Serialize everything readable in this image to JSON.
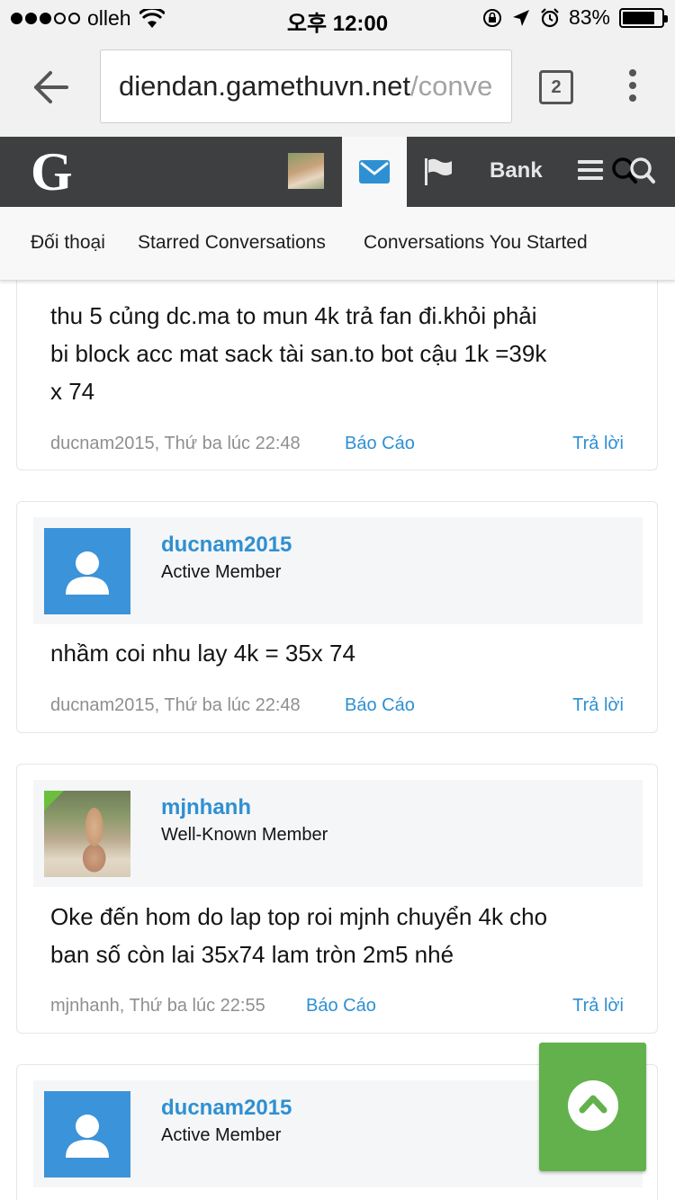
{
  "status_bar": {
    "carrier": "olleh",
    "time": "오후 12:00",
    "battery": "83%",
    "battery_level": 0.83
  },
  "browser": {
    "url_host": "diendan.gamethuvn.net",
    "url_path": "/conve",
    "tab_count": "2"
  },
  "site_header": {
    "logo": "G",
    "bank_label": "Bank",
    "icons": [
      "user-avatar",
      "mail-icon",
      "flag-icon",
      "menu-icon",
      "search-icon"
    ]
  },
  "subnav": {
    "tabs": [
      "Đối thoại",
      "Starred Conversations",
      "Conversations You Started"
    ]
  },
  "messages": [
    {
      "lines": [
        "thu 5 củng dc.ma to mun 4k trả fan đi.khỏi phải",
        "bi block acc mat sack tài san.to bot cậu 1k =39k",
        "x 74"
      ],
      "meta": "ducnam2015, Thứ ba lúc 22:48",
      "report": "Báo Cáo",
      "reply": "Trả lời"
    },
    {
      "user": "ducnam2015",
      "title": "Active Member",
      "lines": [
        "nhầm coi nhu lay 4k = 35x 74"
      ],
      "meta": "ducnam2015, Thứ ba lúc 22:48",
      "report": "Báo Cáo",
      "reply": "Trả lời"
    },
    {
      "user": "mjnhanh",
      "title": "Well-Known Member",
      "lines": [
        "Oke đến hom do lap top roi mjnh chuyển 4k cho",
        "ban số còn lai 35x74 lam tròn 2m5 nhé"
      ],
      "meta": "mjnhanh, Thứ ba lúc 22:55",
      "report": "Báo Cáo",
      "reply": "Trả lời"
    },
    {
      "user": "ducnam2015",
      "title": "Active Member"
    }
  ],
  "colors": {
    "link": "#2e90d2",
    "header_bg": "#3e3f41",
    "avatar_default": "#3b93d9",
    "scroll_top": "#62b14d"
  }
}
